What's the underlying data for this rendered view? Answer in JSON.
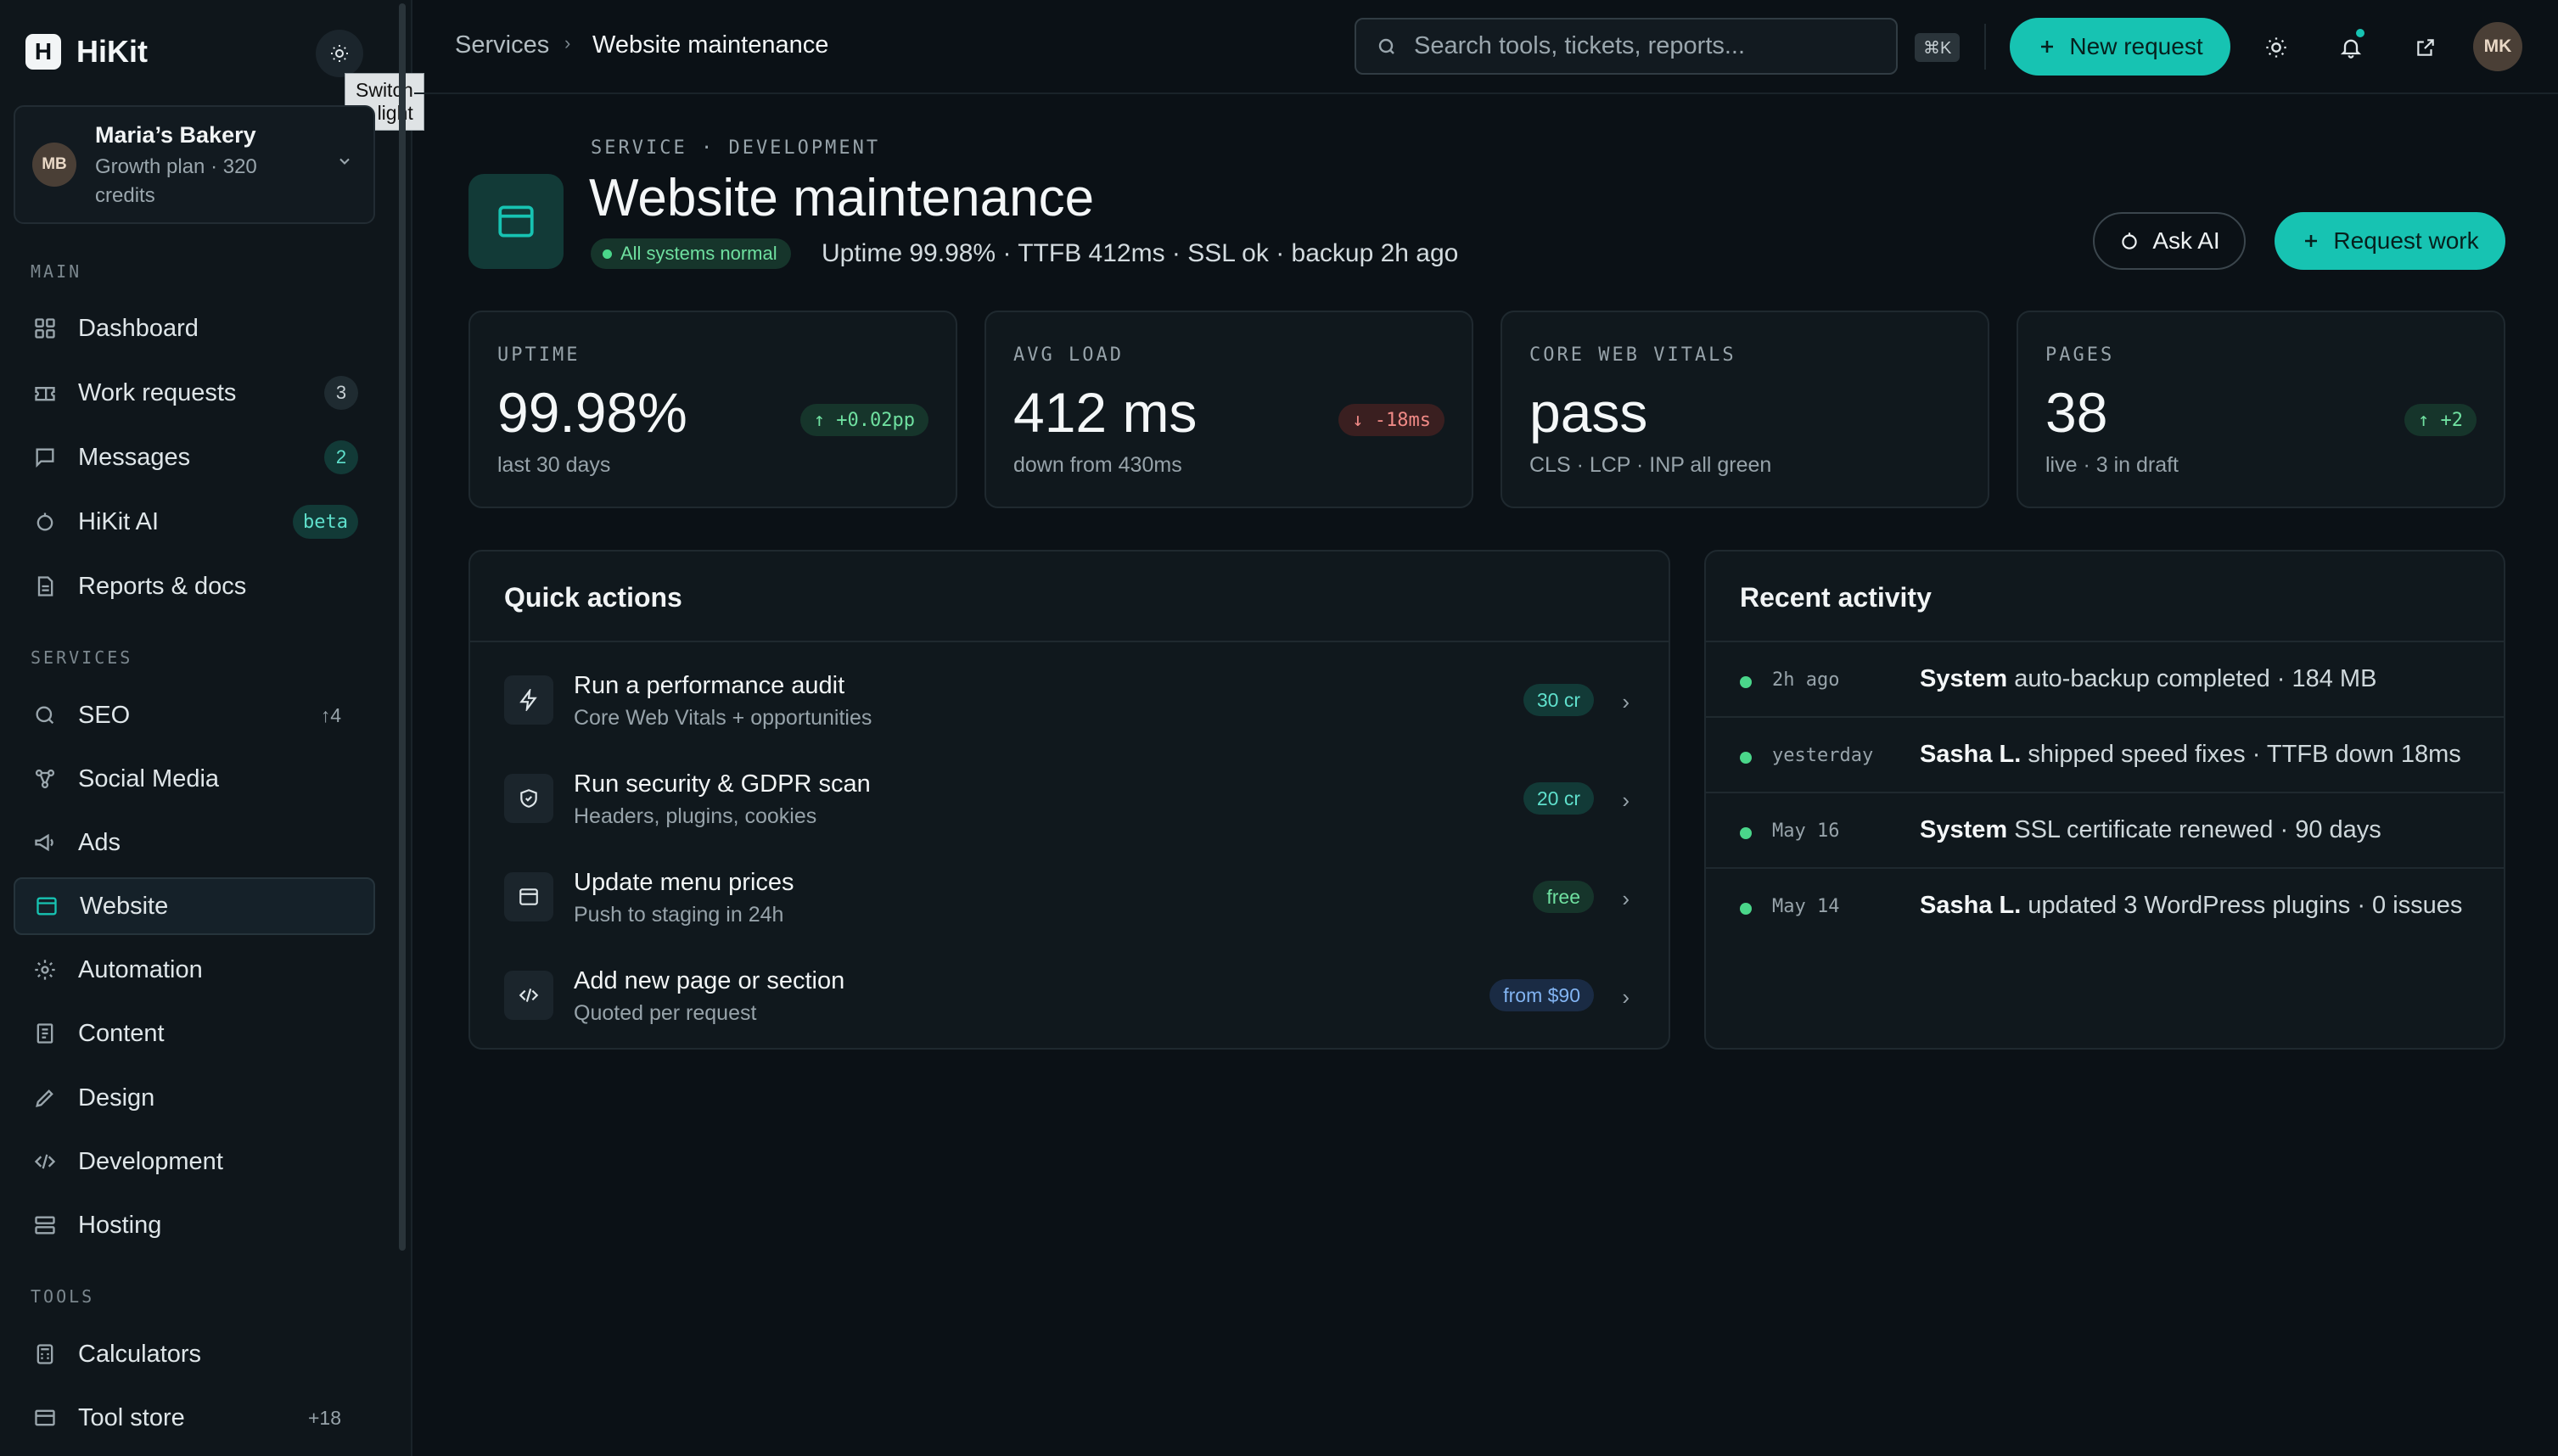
{
  "app": {
    "name": "HiKit",
    "logo_letter": "H",
    "accent": "#17c3b2"
  },
  "tooltip": "Switch to light",
  "account": {
    "initials": "MB",
    "name": "Maria’s Bakery",
    "plan": "Growth plan · 320 credits"
  },
  "sidebar": {
    "main_label": "MAIN",
    "main": [
      {
        "label": "Dashboard",
        "icon": "grid-icon"
      },
      {
        "label": "Work requests",
        "icon": "ticket-icon",
        "badge": "3"
      },
      {
        "label": "Messages",
        "icon": "chat-icon",
        "badge": "2"
      },
      {
        "label": "HiKit AI",
        "icon": "bot-icon",
        "badge": "beta"
      },
      {
        "label": "Reports & docs",
        "icon": "doc-icon"
      }
    ],
    "services_label": "SERVICES",
    "services": [
      {
        "label": "SEO",
        "icon": "search-icon",
        "extra": "↑4"
      },
      {
        "label": "Social Media",
        "icon": "share-icon"
      },
      {
        "label": "Ads",
        "icon": "megaphone-icon"
      },
      {
        "label": "Website",
        "icon": "browser-icon",
        "active": true
      },
      {
        "label": "Automation",
        "icon": "gear-icon"
      },
      {
        "label": "Content",
        "icon": "file-text-icon"
      },
      {
        "label": "Design",
        "icon": "pen-icon"
      },
      {
        "label": "Development",
        "icon": "code-icon"
      },
      {
        "label": "Hosting",
        "icon": "server-icon"
      }
    ],
    "tools_label": "TOOLS",
    "tools": [
      {
        "label": "Calculators",
        "icon": "calculator-icon"
      },
      {
        "label": "Tool store",
        "icon": "store-icon",
        "extra": "+18"
      }
    ]
  },
  "topbar": {
    "breadcrumb": [
      "Services",
      "Website maintenance"
    ],
    "search_placeholder": "Search tools, tickets, reports...",
    "shortcut": "⌘K",
    "new_request": "New request",
    "user_initials": "MK"
  },
  "header": {
    "eyebrow": "SERVICE · DEVELOPMENT",
    "title": "Website maintenance",
    "status": "All systems normal",
    "subtitle": "Uptime 99.98% · TTFB 412ms · SSL ok · backup 2h ago",
    "ask_ai": "Ask AI",
    "request_work": "Request work"
  },
  "stats": [
    {
      "label": "UPTIME",
      "value": "99.98%",
      "note": "last 30 days",
      "chip": "↑ +0.02pp",
      "trend": "up"
    },
    {
      "label": "AVG LOAD",
      "value": "412 ms",
      "note": "down from 430ms",
      "chip": "↓ -18ms",
      "trend": "down"
    },
    {
      "label": "CORE WEB VITALS",
      "value": "pass",
      "note": "CLS · LCP · INP all green"
    },
    {
      "label": "PAGES",
      "value": "38",
      "note": "live · 3 in draft",
      "chip": "↑ +2",
      "trend": "up"
    }
  ],
  "quick_actions": {
    "title": "Quick actions",
    "items": [
      {
        "title": "Run a performance audit",
        "sub": "Core Web Vitals + opportunities",
        "price": "30 cr",
        "icon": "bolt-icon"
      },
      {
        "title": "Run security & GDPR scan",
        "sub": "Headers, plugins, cookies",
        "price": "20 cr",
        "icon": "shield-icon"
      },
      {
        "title": "Update menu prices",
        "sub": "Push to staging in 24h",
        "price": "free",
        "icon": "browser-icon"
      },
      {
        "title": "Add new page or section",
        "sub": "Quoted per request",
        "price": "from $90",
        "icon": "code-icon"
      }
    ]
  },
  "activity": {
    "title": "Recent activity",
    "items": [
      {
        "time": "2h ago",
        "actor": "System",
        "text": "auto-backup completed · 184 MB"
      },
      {
        "time": "yesterday",
        "actor": "Sasha L.",
        "text": "shipped speed fixes · TTFB down 18ms"
      },
      {
        "time": "May 16",
        "actor": "System",
        "text": "SSL certificate renewed · 90 days"
      },
      {
        "time": "May 14",
        "actor": "Sasha L.",
        "text": "updated 3 WordPress plugins · 0 issues"
      }
    ]
  }
}
